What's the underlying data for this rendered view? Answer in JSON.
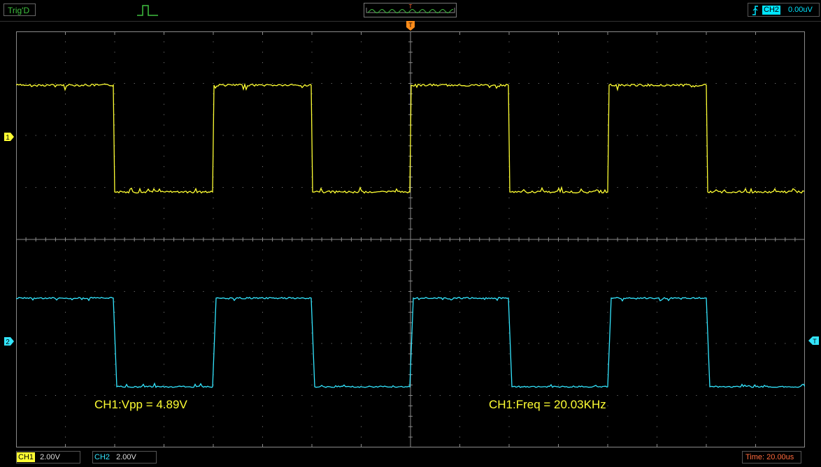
{
  "topbar": {
    "trig_status": "Trig'D",
    "overview_trigger_letter": "T",
    "trigger_source": "CH2",
    "trigger_level": "0.00uV"
  },
  "markers": {
    "trigger_time": "T",
    "ch1": "1",
    "ch2": "2",
    "trigger_level": "T"
  },
  "measurements": {
    "vpp": "CH1:Vpp = 4.89V",
    "freq": "CH1:Freq = 20.03KHz"
  },
  "bottombar": {
    "ch1_label": "CH1",
    "ch1_scale": "2.00V",
    "ch2_label": "CH2",
    "ch2_scale": "2.00V",
    "time_scale": "Time: 20.00us"
  },
  "colors": {
    "ch1": "#ffff33",
    "ch2": "#33e6ff",
    "trigger": "#ff8c1a",
    "grid": "#8a8a8a"
  }
}
